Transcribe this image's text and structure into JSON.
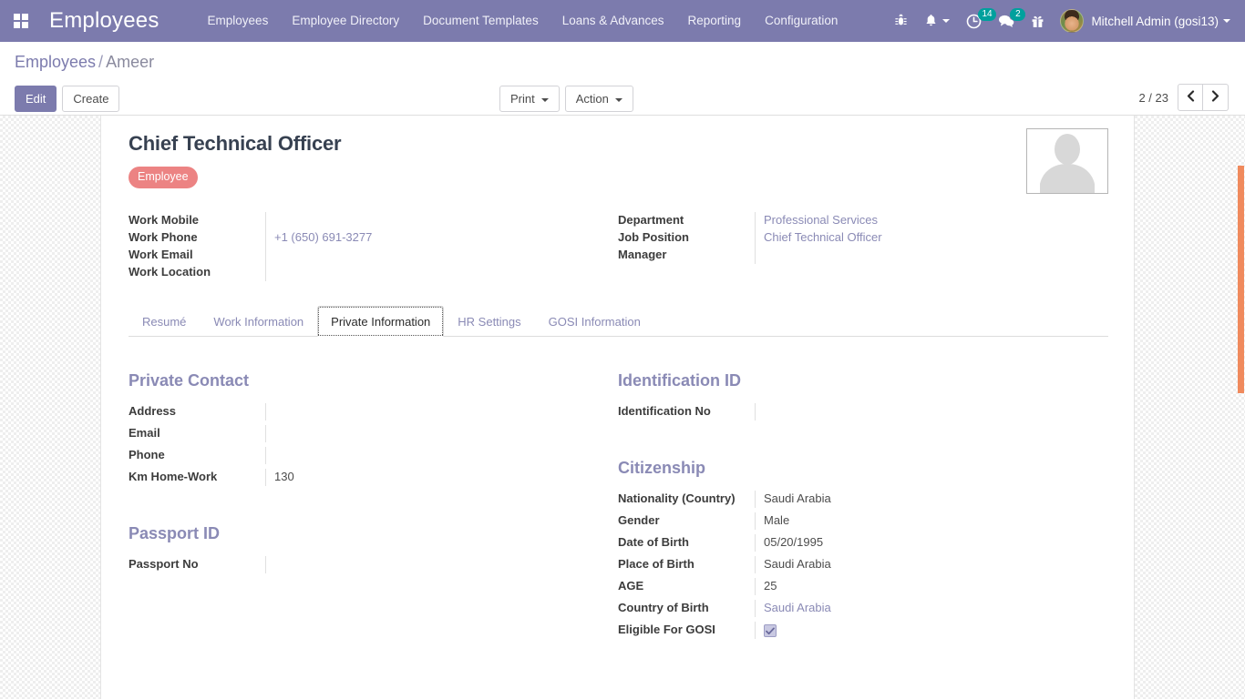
{
  "navbar": {
    "apps_icon": "apps-grid-icon",
    "brand": "Employees",
    "menu": [
      {
        "label": "Employees",
        "name": "menu-employees"
      },
      {
        "label": "Employee Directory",
        "name": "menu-employee-directory"
      },
      {
        "label": "Document Templates",
        "name": "menu-document-templates"
      },
      {
        "label": "Loans & Advances",
        "name": "menu-loans-advances"
      },
      {
        "label": "Reporting",
        "name": "menu-reporting"
      },
      {
        "label": "Configuration",
        "name": "menu-configuration"
      }
    ],
    "icons": {
      "bug": "bug-icon",
      "bell": "bell-icon",
      "activity": "clock-activity-icon",
      "messages": "chat-bubble-icon",
      "gift": "gift-icon"
    },
    "activity_count": "14",
    "message_count": "2",
    "user_name": "Mitchell Admin (gosi13)",
    "accent_color": "#7c7bad",
    "badge_color": "#00A09D"
  },
  "control_panel": {
    "breadcrumb_root": "Employees",
    "breadcrumb_sep": "/",
    "breadcrumb_current": "Ameer",
    "edit_label": "Edit",
    "create_label": "Create",
    "print_label": "Print",
    "action_label": "Action",
    "pager_text": "2 / 23",
    "prev_icon": "chevron-left-icon",
    "next_icon": "chevron-right-icon"
  },
  "form": {
    "title": "Chief Technical Officer",
    "tag": "Employee",
    "tag_color": "#ec8383",
    "avatar_icon": "person-placeholder-icon",
    "header_left": [
      {
        "label": "Work Mobile",
        "value": "",
        "link": false
      },
      {
        "label": "Work Phone",
        "value": "+1 (650) 691-3277",
        "link": true
      },
      {
        "label": "Work Email",
        "value": "",
        "link": false
      },
      {
        "label": "Work Location",
        "value": "",
        "link": false
      }
    ],
    "header_right": [
      {
        "label": "Department",
        "value": "Professional Services",
        "link": true
      },
      {
        "label": "Job Position",
        "value": "Chief Technical Officer",
        "link": true
      },
      {
        "label": "Manager",
        "value": "",
        "link": false
      }
    ],
    "tabs": [
      {
        "label": "Resumé",
        "active": false
      },
      {
        "label": "Work Information",
        "active": false
      },
      {
        "label": "Private Information",
        "active": true
      },
      {
        "label": "HR Settings",
        "active": false
      },
      {
        "label": "GOSI Information",
        "active": false
      }
    ],
    "sections": {
      "private_contact": {
        "title": "Private Contact",
        "fields": [
          {
            "label": "Address",
            "value": "",
            "link": false
          },
          {
            "label": "Email",
            "value": "",
            "link": false
          },
          {
            "label": "Phone",
            "value": "",
            "link": false
          },
          {
            "label": "Km Home-Work",
            "value": "130",
            "link": false
          }
        ]
      },
      "passport_id": {
        "title": "Passport ID",
        "fields": [
          {
            "label": "Passport No",
            "value": "",
            "link": false
          }
        ]
      },
      "identification_id": {
        "title": "Identification ID",
        "fields": [
          {
            "label": "Identification No",
            "value": "",
            "link": false
          }
        ]
      },
      "citizenship": {
        "title": "Citizenship",
        "fields": [
          {
            "label": "Nationality (Country)",
            "value": "Saudi Arabia",
            "link": false
          },
          {
            "label": "Gender",
            "value": "Male",
            "link": false
          },
          {
            "label": "Date of Birth",
            "value": "05/20/1995",
            "link": false
          },
          {
            "label": "Place of Birth",
            "value": "Saudi Arabia",
            "link": false
          },
          {
            "label": "AGE",
            "value": "25",
            "link": false
          },
          {
            "label": "Country of Birth",
            "value": "Saudi Arabia",
            "link": true
          },
          {
            "label": "Eligible For GOSI",
            "value": "checked",
            "checkbox": true
          }
        ]
      }
    }
  },
  "scrollbar": {
    "thumb_color": "#f08a5d"
  }
}
